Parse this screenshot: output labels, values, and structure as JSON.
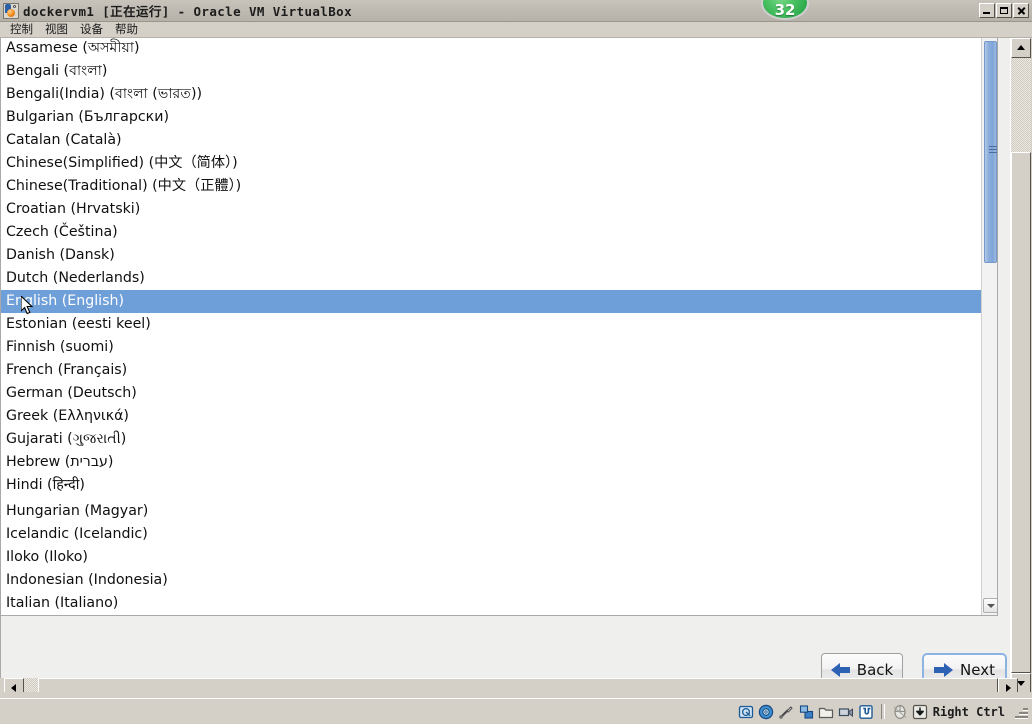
{
  "window": {
    "title": "dockervm1 [正在运行] - Oracle VM VirtualBox",
    "app_icon": "virtualbox-icon",
    "badge": "32",
    "buttons": {
      "minimize": "minimize-icon",
      "maximize": "maximize-icon",
      "close": "close-icon"
    }
  },
  "menubar": {
    "items": [
      {
        "label": "控制"
      },
      {
        "label": "视图"
      },
      {
        "label": "设备"
      },
      {
        "label": "帮助"
      }
    ]
  },
  "guest": {
    "language_list": {
      "selected": "English (English)",
      "items": [
        {
          "label": "Assamese (অসমীয়া)"
        },
        {
          "label": "Bengali (বাংলা)"
        },
        {
          "label": "Bengali(India) (বাংলা (ভারত))"
        },
        {
          "label": "Bulgarian (Български)"
        },
        {
          "label": "Catalan (Català)"
        },
        {
          "label": "Chinese(Simplified) (中文（简体）)"
        },
        {
          "label": "Chinese(Traditional) (中文（正體）)"
        },
        {
          "label": "Croatian (Hrvatski)"
        },
        {
          "label": "Czech (Čeština)"
        },
        {
          "label": "Danish (Dansk)"
        },
        {
          "label": "Dutch (Nederlands)"
        },
        {
          "label": "English (English)"
        },
        {
          "label": "Estonian (eesti keel)"
        },
        {
          "label": "Finnish (suomi)"
        },
        {
          "label": "French (Français)"
        },
        {
          "label": "German (Deutsch)"
        },
        {
          "label": "Greek (Ελληνικά)"
        },
        {
          "label": "Gujarati (ગુજરાતી)"
        },
        {
          "label": "Hebrew (עברית)"
        },
        {
          "label": "Hindi (हिन्दी)"
        },
        {
          "label": "Hungarian (Magyar)"
        },
        {
          "label": "Icelandic (Icelandic)"
        },
        {
          "label": "Iloko (Iloko)"
        },
        {
          "label": "Indonesian (Indonesia)"
        },
        {
          "label": "Italian (Italiano)"
        }
      ]
    },
    "buttons": {
      "back": "Back",
      "next": "Next"
    }
  },
  "statusbar": {
    "icons": [
      "harddisk-icon",
      "optical-disk-icon",
      "usb-icon",
      "network-icon",
      "shared-folder-icon",
      "video-capture-icon",
      "vm-features-icon",
      "mouse-integration-icon",
      "keyboard-capture-icon"
    ],
    "host_key": "Right Ctrl"
  },
  "colors": {
    "selection": "#6f9fd8",
    "badge_green": "#49c162",
    "arrow_blue": "#2c61b3",
    "window_chrome": "#d4d0c8"
  }
}
